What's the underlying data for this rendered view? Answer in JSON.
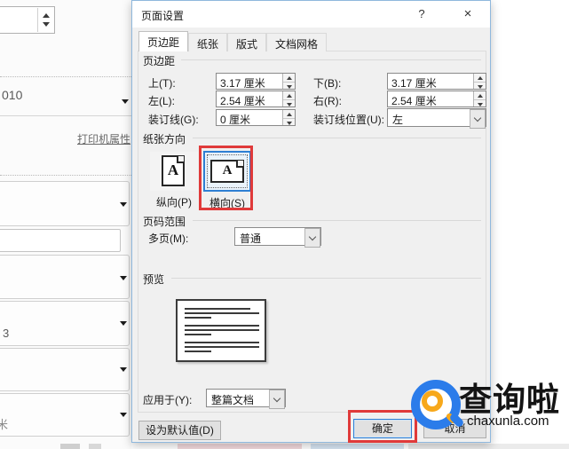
{
  "background": {
    "printer_properties_link": "打印机属性",
    "partial_text_copies": "010",
    "partial_text_pages": "3",
    "partial_text_bottom": "米"
  },
  "dialog": {
    "title": "页面设置",
    "help_button": "?",
    "close_button": "×",
    "tabs": [
      {
        "label": "页边距",
        "active": true
      },
      {
        "label": "纸张",
        "active": false
      },
      {
        "label": "版式",
        "active": false
      },
      {
        "label": "文档网格",
        "active": false
      }
    ],
    "margins_group": {
      "title": "页边距",
      "top_label": "上(T):",
      "top_value": "3.17 厘米",
      "bottom_label": "下(B):",
      "bottom_value": "3.17 厘米",
      "left_label": "左(L):",
      "left_value": "2.54 厘米",
      "right_label": "右(R):",
      "right_value": "2.54 厘米",
      "gutter_label": "装订线(G):",
      "gutter_value": "0 厘米",
      "gutter_pos_label": "装订线位置(U):",
      "gutter_pos_value": "左"
    },
    "orientation_group": {
      "title": "纸张方向",
      "portrait_label": "纵向(P)",
      "landscape_label": "横向(S)",
      "selected": "landscape",
      "icon_letter": "A"
    },
    "pages_group": {
      "title": "页码范围",
      "multi_label": "多页(M):",
      "multi_value": "普通"
    },
    "preview_group": {
      "title": "预览",
      "apply_label": "应用于(Y):",
      "apply_value": "整篇文档"
    },
    "buttons": {
      "set_default": "设为默认值(D)",
      "ok": "确定",
      "cancel": "取消"
    }
  },
  "watermark": {
    "brand": "查询啦",
    "domain": "chaxunla.com"
  },
  "colors": {
    "annotation_red": "#e03a3a",
    "selection_blue": "#2f7fd3",
    "logo_blue": "#2b7cea",
    "logo_orange": "#f7a81b"
  }
}
